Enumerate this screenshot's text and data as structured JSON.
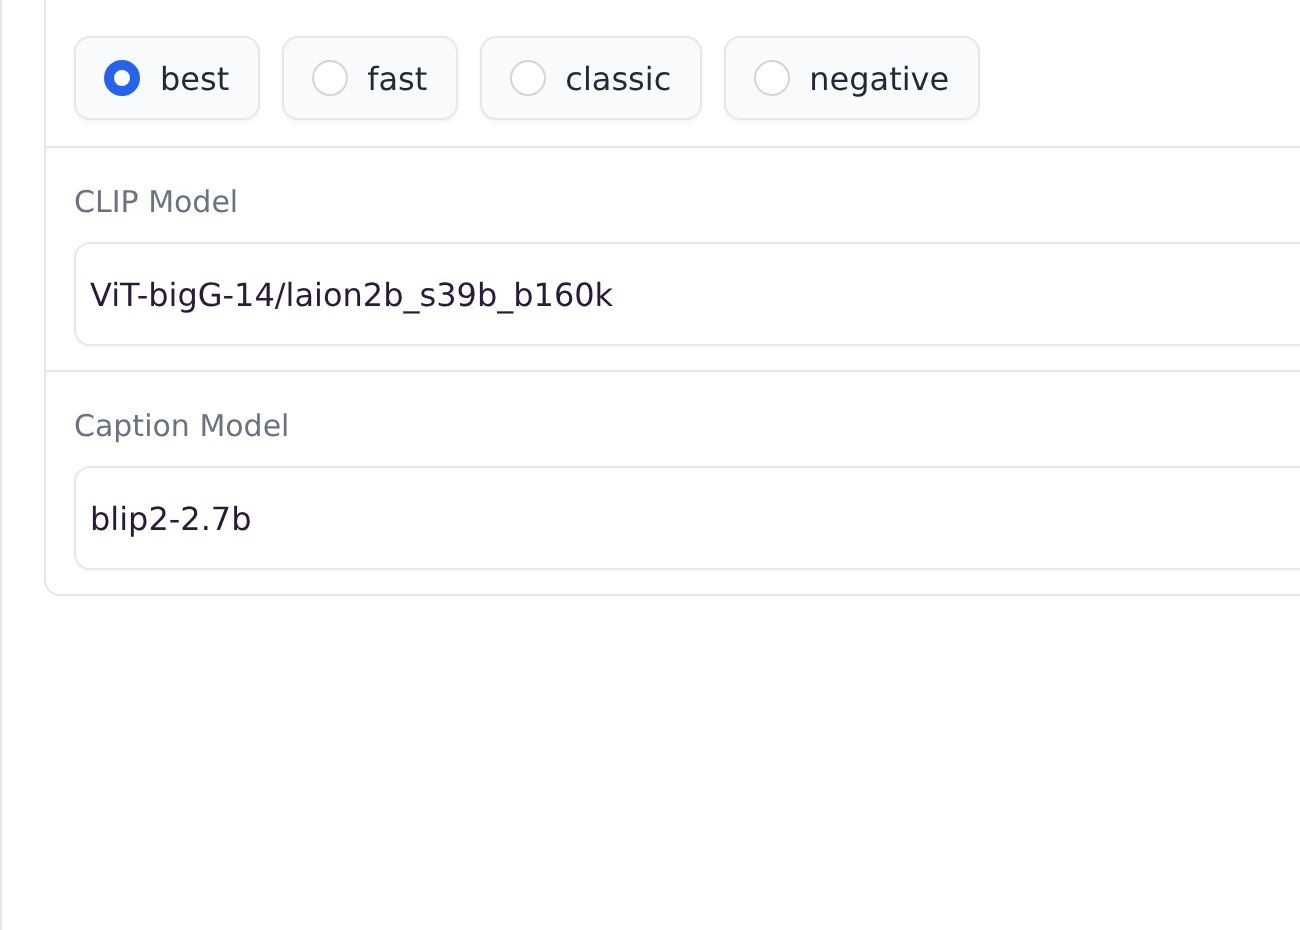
{
  "mode": {
    "options": [
      {
        "label": "best",
        "selected": true
      },
      {
        "label": "fast",
        "selected": false
      },
      {
        "label": "classic",
        "selected": false
      },
      {
        "label": "negative",
        "selected": false
      }
    ]
  },
  "clip_model": {
    "label": "CLIP Model",
    "value": "ViT-bigG-14/laion2b_s39b_b160k"
  },
  "caption_model": {
    "label": "Caption Model",
    "value": "blip2-2.7b"
  }
}
